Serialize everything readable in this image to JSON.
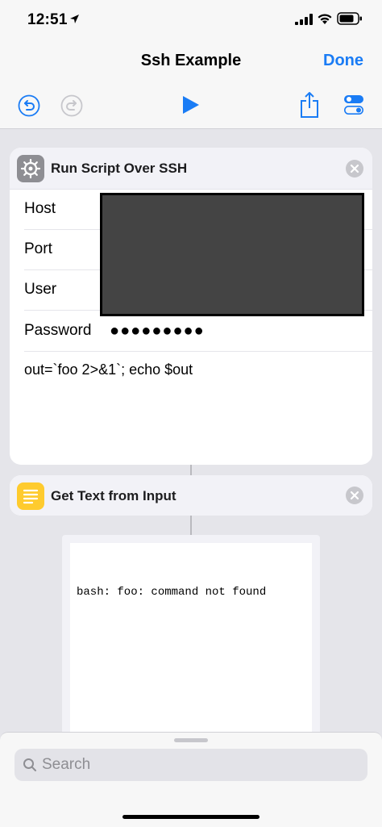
{
  "status_bar": {
    "time": "12:51"
  },
  "nav": {
    "title": "Ssh Example",
    "done_label": "Done"
  },
  "colors": {
    "accent": "#1a7cf5",
    "gear_tile": "#8e8e93",
    "note_tile": "#fecb2e"
  },
  "ssh_action": {
    "title": "Run Script Over SSH",
    "icon": "gear-icon",
    "fields": [
      {
        "label": "Host"
      },
      {
        "label": "Port"
      },
      {
        "label": "User"
      },
      {
        "label": "Password",
        "value": "●●●●●●●●●"
      }
    ],
    "script": "out=`foo 2>&1`; echo $out"
  },
  "text_action": {
    "title": "Get Text from Input",
    "icon": "note-icon",
    "output": "bash: foo: command not found"
  },
  "search": {
    "placeholder": "Search"
  }
}
